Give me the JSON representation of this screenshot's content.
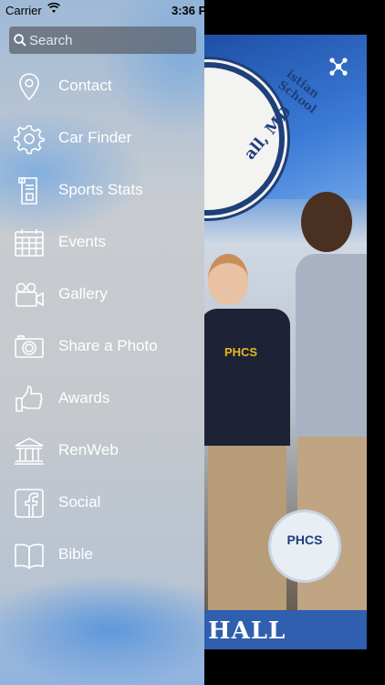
{
  "status_bar": {
    "carrier": "Carrier",
    "time": "3:36 P"
  },
  "search": {
    "placeholder": "Search"
  },
  "menu": {
    "items": [
      {
        "label": "Contact",
        "icon": "map-pin-icon"
      },
      {
        "label": "Car Finder",
        "icon": "gear-icon"
      },
      {
        "label": "Sports Stats",
        "icon": "document-icon"
      },
      {
        "label": "Events",
        "icon": "calendar-icon"
      },
      {
        "label": "Gallery",
        "icon": "video-camera-icon"
      },
      {
        "label": "Share a Photo",
        "icon": "camera-icon"
      },
      {
        "label": "Awards",
        "icon": "thumbs-up-icon"
      },
      {
        "label": "RenWeb",
        "icon": "building-icon"
      },
      {
        "label": "Social",
        "icon": "facebook-icon"
      },
      {
        "label": "Bible",
        "icon": "book-icon"
      }
    ]
  },
  "background": {
    "seal_text_top": "istian School",
    "seal_text_bottom": "all, MD",
    "shirt_logo": "PHCS",
    "badge_logo": "PHCS",
    "banner_text": "HALL"
  },
  "colors": {
    "drawer_text": "#ffffff",
    "banner_blue": "#2f5fae",
    "seal_navy": "#1e3f7a"
  }
}
